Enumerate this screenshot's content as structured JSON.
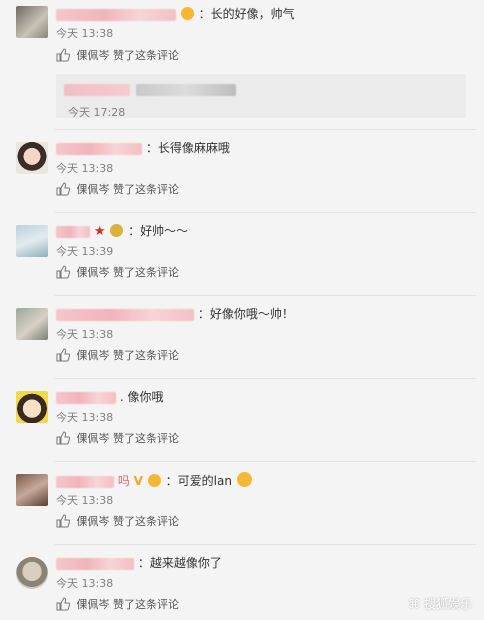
{
  "comments": [
    {
      "text": "：长的好像，帅气",
      "time": "今天 13:38",
      "liker": "倮佩岑",
      "like_text": "赞了这条评论"
    },
    {
      "text": "：长得像麻麻哦",
      "time": "今天 13:38",
      "liker": "倮佩岑",
      "like_text": "赞了这条评论"
    },
    {
      "text": "：好帅～～",
      "time": "今天 13:39",
      "liker": "倮佩岑",
      "like_text": "赞了这条评论"
    },
    {
      "text": "：好像你哦～帅！",
      "time": "今天 13:38",
      "liker": "倮佩岑",
      "like_text": "赞了这条评论"
    },
    {
      "text": ". 像你哦",
      "time": "今天 13:38",
      "liker": "倮佩岑",
      "like_text": "赞了这条评论"
    },
    {
      "name_suffix": "吗",
      "text": "：可爱的lan",
      "time": "今天 13:38",
      "liker": "倮佩岑",
      "like_text": "赞了这条评论"
    },
    {
      "text": "：越来越像你了",
      "time": "今天 13:38",
      "liker": "倮佩岑",
      "like_text": "赞了这条评论"
    }
  ],
  "reply": {
    "time": "今天 17:28"
  },
  "watermark": "搜狐娱乐",
  "colors": {
    "background": "#f4f4f4",
    "blurred_name": "#f0b5bb",
    "time": "#808080",
    "divider": "#e2e2e2"
  }
}
